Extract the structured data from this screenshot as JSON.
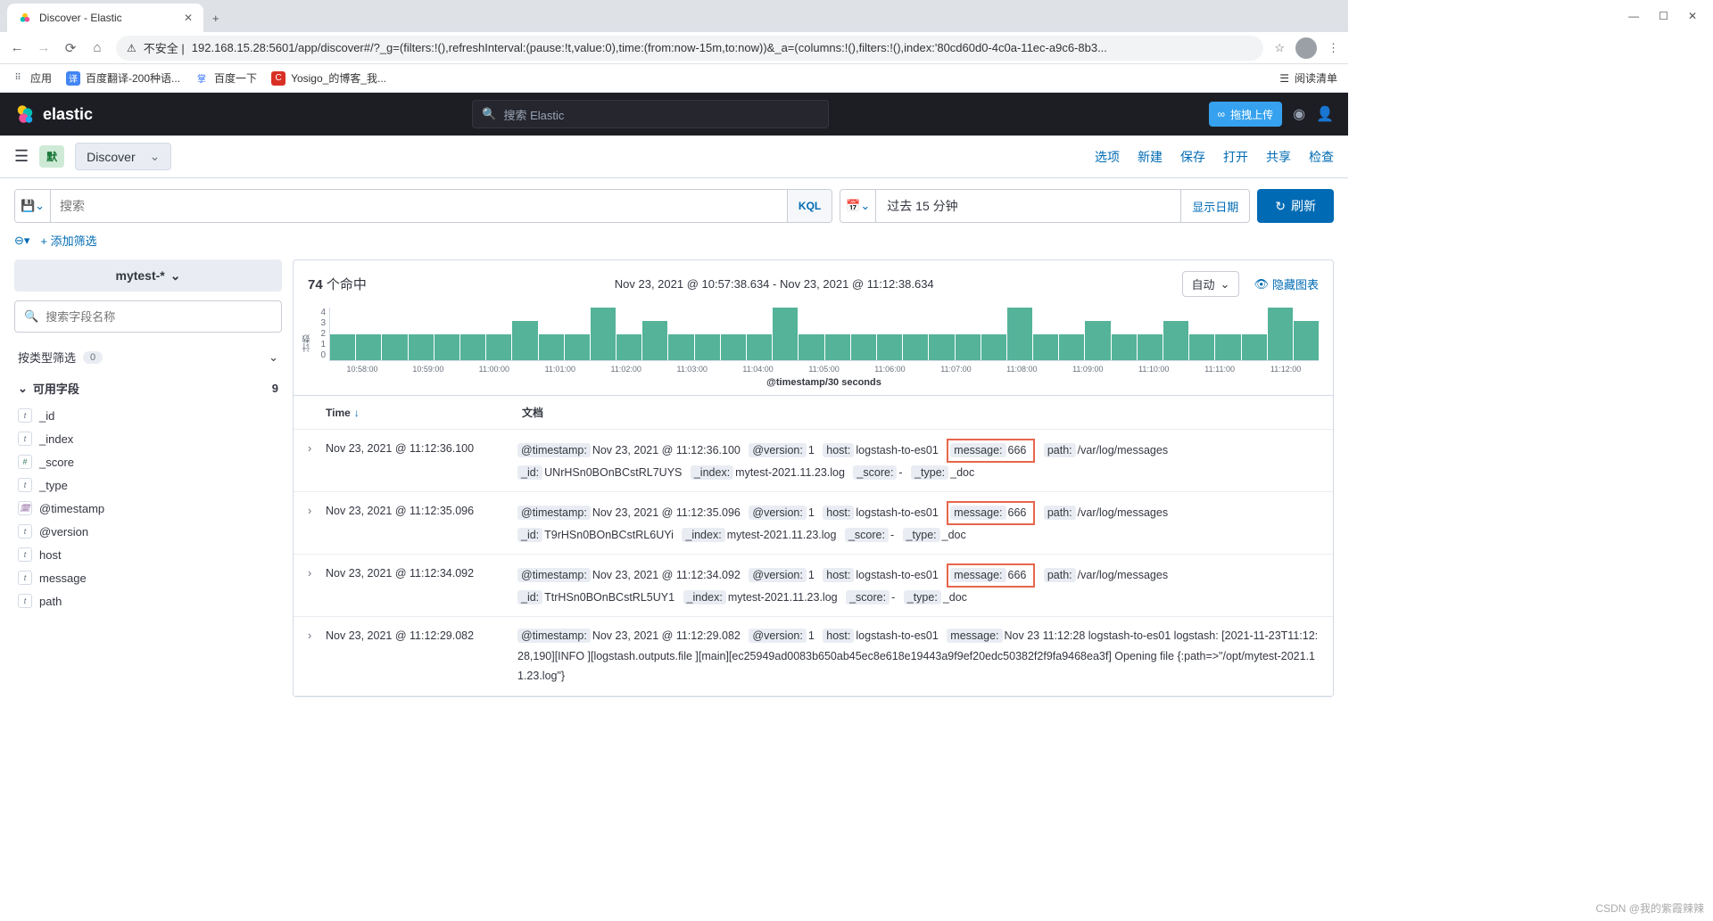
{
  "browser": {
    "tab_title": "Discover - Elastic",
    "url_prefix": "不安全 |",
    "url": "192.168.15.28:5601/app/discover#/?_g=(filters:!(),refreshInterval:(pause:!t,value:0),time:(from:now-15m,to:now))&_a=(columns:!(),filters:!(),index:'80cd60d0-4c0a-11ec-a9c6-8b3...",
    "bookmarks": {
      "apps": "应用",
      "b1": "百度翻译-200种语...",
      "b2": "百度一下",
      "b3": "Yosigo_的博客_我...",
      "reading": "阅读清单"
    }
  },
  "header": {
    "brand": "elastic",
    "search_placeholder": "搜索 Elastic",
    "upload": "拖拽上传"
  },
  "subheader": {
    "badge": "默",
    "discover": "Discover",
    "links": {
      "options": "选项",
      "new": "新建",
      "save": "保存",
      "open": "打开",
      "share": "共享",
      "inspect": "检查"
    }
  },
  "query": {
    "search_placeholder": "搜索",
    "kql": "KQL",
    "time_range": "过去 15 分钟",
    "show_dates": "显示日期",
    "refresh": "刷新",
    "add_filter": "+ 添加筛选"
  },
  "sidebar": {
    "index": "mytest-*",
    "search_placeholder": "搜索字段名称",
    "filter_by_type": "按类型筛选",
    "filter_count": "0",
    "available": "可用字段",
    "available_count": "9",
    "fields": [
      {
        "type": "t",
        "name": "_id"
      },
      {
        "type": "t",
        "name": "_index"
      },
      {
        "type": "#",
        "name": "_score"
      },
      {
        "type": "t",
        "name": "_type"
      },
      {
        "type": "d",
        "name": "@timestamp"
      },
      {
        "type": "t",
        "name": "@version"
      },
      {
        "type": "t",
        "name": "host"
      },
      {
        "type": "t",
        "name": "message"
      },
      {
        "type": "t",
        "name": "path"
      }
    ]
  },
  "content": {
    "hits_count": "74",
    "hits_label": "个命中",
    "time_range": "Nov 23, 2021 @ 10:57:38.634 - Nov 23, 2021 @ 11:12:38.634",
    "auto": "自动",
    "hide_chart": "隐藏图表",
    "xlabel": "@timestamp/30 seconds",
    "ylabel": "计数",
    "col_time": "Time",
    "col_doc": "文档"
  },
  "chart_data": {
    "type": "bar",
    "ylim": [
      0,
      4
    ],
    "yticks": [
      4,
      3,
      2,
      1,
      0
    ],
    "xticks": [
      "10:58:00",
      "10:59:00",
      "11:00:00",
      "11:01:00",
      "11:02:00",
      "11:03:00",
      "11:04:00",
      "11:05:00",
      "11:06:00",
      "11:07:00",
      "11:08:00",
      "11:09:00",
      "11:10:00",
      "11:11:00",
      "11:12:00"
    ],
    "values": [
      2,
      2,
      2,
      2,
      2,
      2,
      2,
      3,
      2,
      2,
      4,
      2,
      3,
      2,
      2,
      2,
      2,
      4,
      2,
      2,
      2,
      2,
      2,
      2,
      2,
      2,
      4,
      2,
      2,
      3,
      2,
      2,
      3,
      2,
      2,
      2,
      4,
      3
    ]
  },
  "rows": [
    {
      "time": "Nov 23, 2021 @ 11:12:36.100",
      "highlight_msg": true,
      "fields": {
        "timestamp": "Nov 23, 2021 @ 11:12:36.100",
        "version": "1",
        "host": "logstash-to-es01",
        "message": "666",
        "path": "/var/log/messages",
        "_id": "UNrHSn0BOnBCstRL7UYS",
        "_index": "mytest-2021.11.23.log",
        "_score": "-",
        "_type": "_doc"
      }
    },
    {
      "time": "Nov 23, 2021 @ 11:12:35.096",
      "highlight_msg": true,
      "fields": {
        "timestamp": "Nov 23, 2021 @ 11:12:35.096",
        "version": "1",
        "host": "logstash-to-es01",
        "message": "666",
        "path": "/var/log/messages",
        "_id": "T9rHSn0BOnBCstRL6UYi",
        "_index": "mytest-2021.11.23.log",
        "_score": "-",
        "_type": "_doc"
      }
    },
    {
      "time": "Nov 23, 2021 @ 11:12:34.092",
      "highlight_msg": true,
      "fields": {
        "timestamp": "Nov 23, 2021 @ 11:12:34.092",
        "version": "1",
        "host": "logstash-to-es01",
        "message": "666",
        "path": "/var/log/messages",
        "_id": "TtrHSn0BOnBCstRL5UY1",
        "_index": "mytest-2021.11.23.log",
        "_score": "-",
        "_type": "_doc"
      }
    },
    {
      "time": "Nov 23, 2021 @ 11:12:29.082",
      "highlight_msg": false,
      "fields": {
        "timestamp": "Nov 23, 2021 @ 11:12:29.082",
        "version": "1",
        "host": "logstash-to-es01",
        "message": "Nov 23 11:12:28 logstash-to-es01 logstash: [2021-11-23T11:12:28,190][INFO ][logstash.outputs.file ][main][ec25949ad0083b650ab45ec8e618e19443a9f9ef20edc50382f2f9fa9468ea3f] Opening file {:path=>\"/opt/mytest-2021.11.23.log\"}"
      }
    }
  ],
  "watermark": "CSDN @我的紫霞辣辣"
}
